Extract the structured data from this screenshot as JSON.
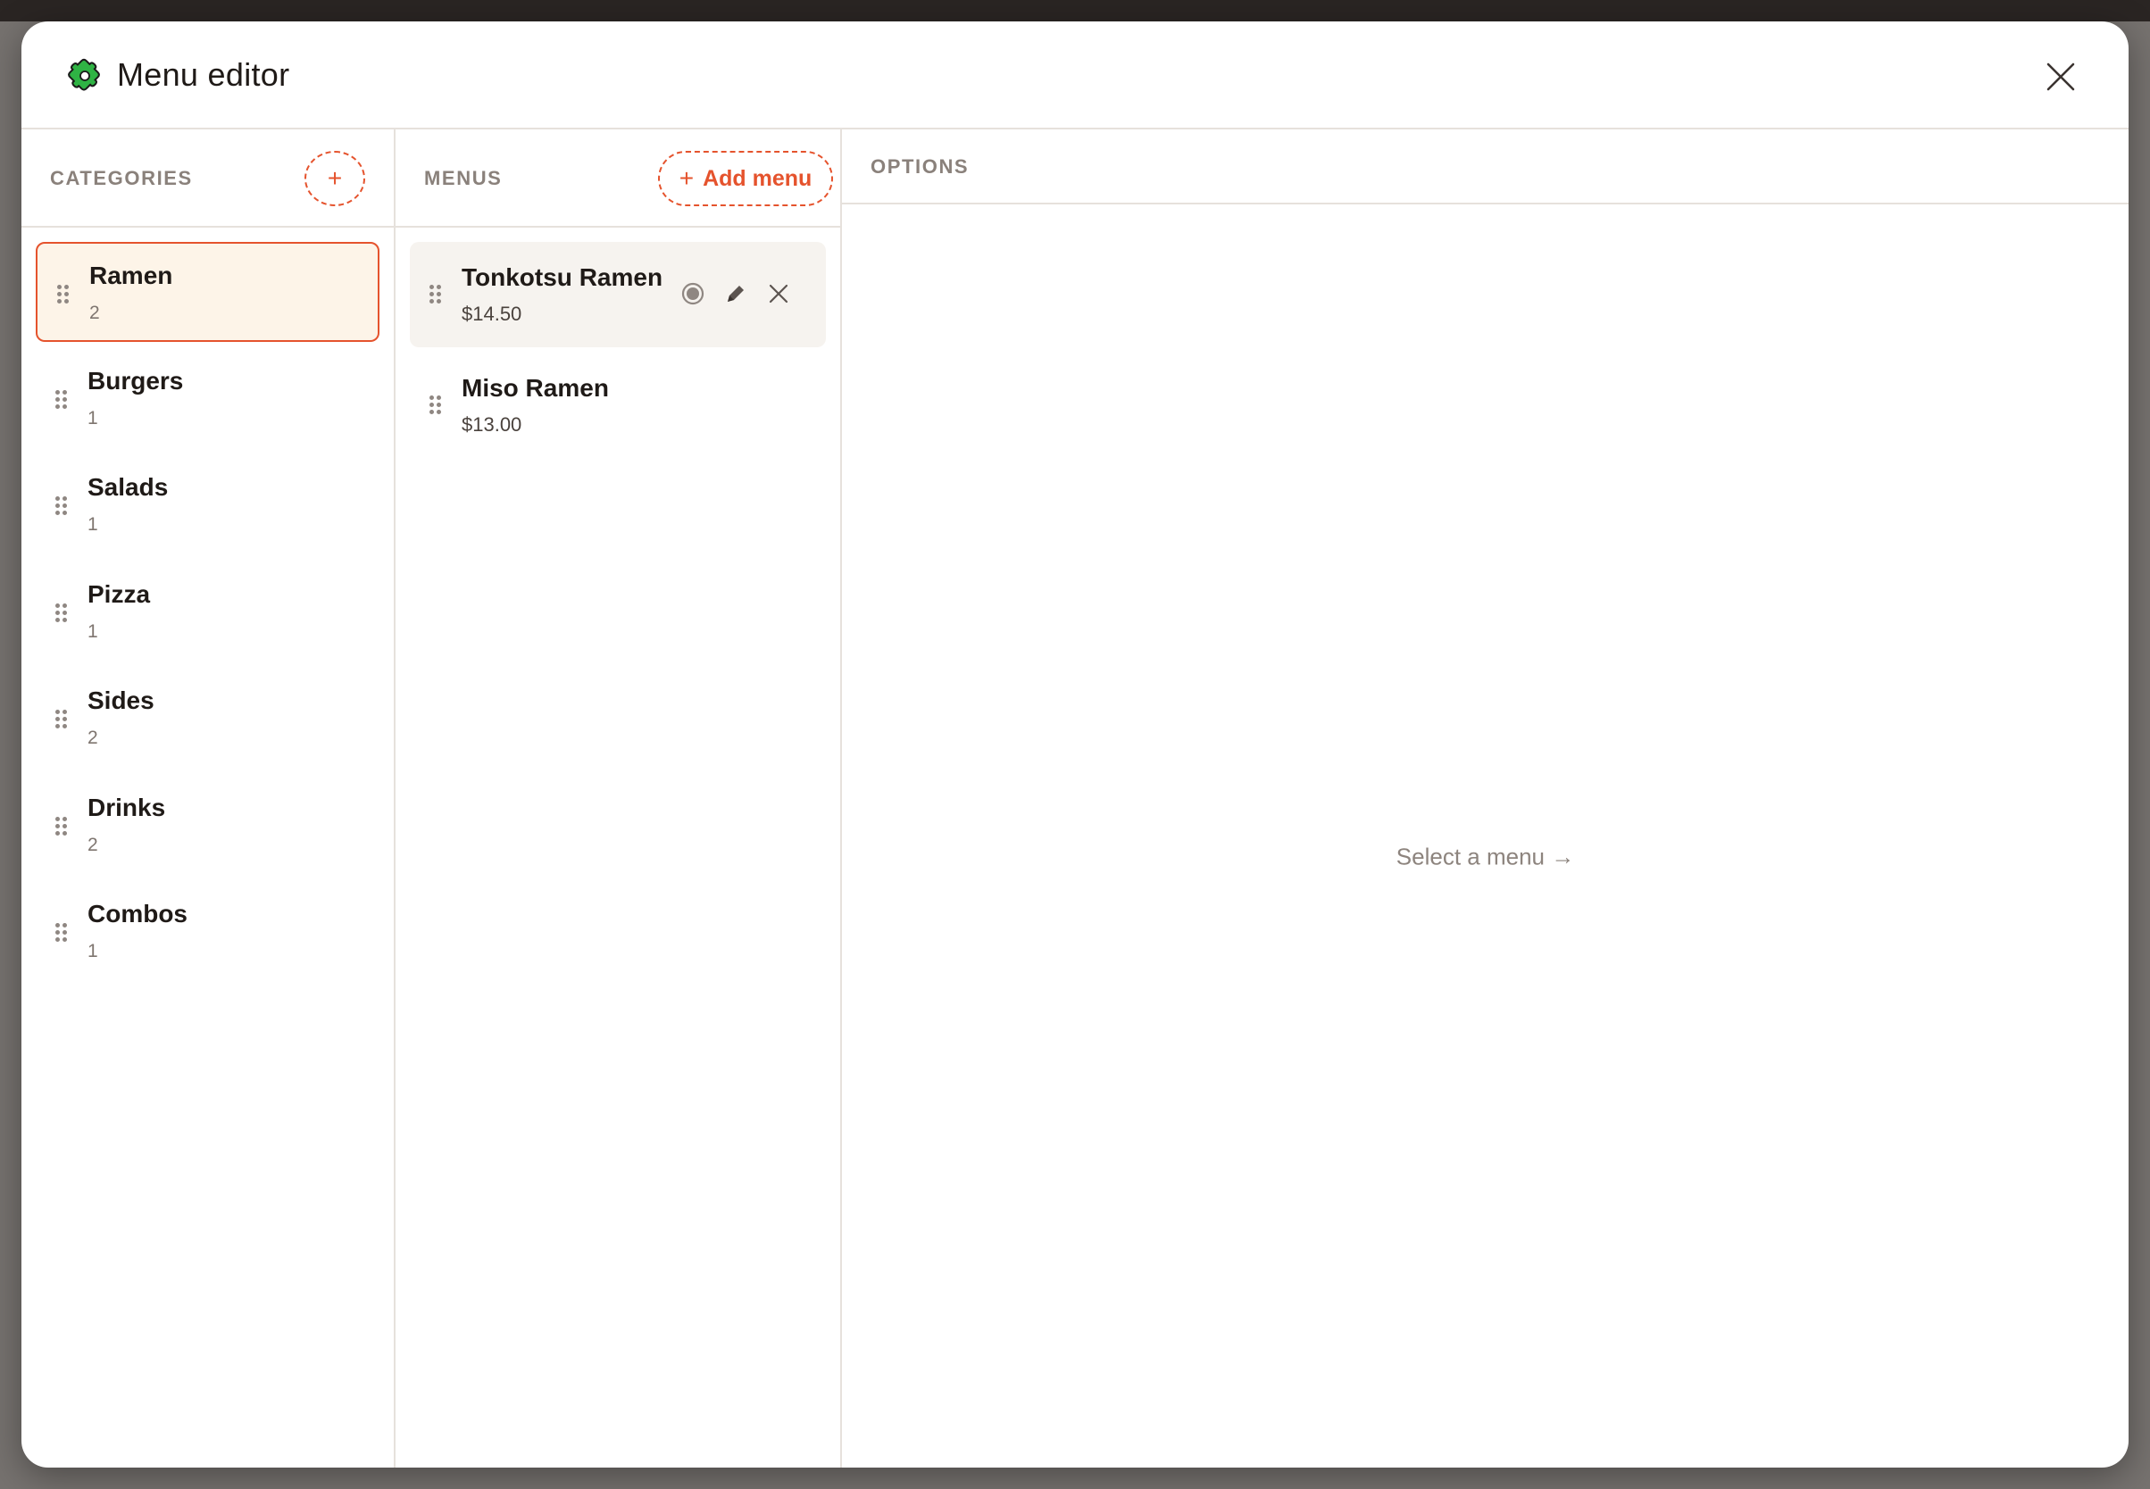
{
  "modal": {
    "title": "Menu editor",
    "logo_icon": "puzzle-icon",
    "close_icon": "close-icon"
  },
  "categories": {
    "header": "CATEGORIES",
    "add_label": "+",
    "items": [
      {
        "name": "Ramen",
        "count": "2",
        "selected": true
      },
      {
        "name": "Burgers",
        "count": "1"
      },
      {
        "name": "Salads",
        "count": "1"
      },
      {
        "name": "Pizza",
        "count": "1"
      },
      {
        "name": "Sides",
        "count": "2"
      },
      {
        "name": "Drinks",
        "count": "2"
      },
      {
        "name": "Combos",
        "count": "1"
      }
    ]
  },
  "menus": {
    "header": "MENUS",
    "add_plus": "+",
    "add_label": "Add menu",
    "items": [
      {
        "name": "Tonkotsu Ramen",
        "price": "$14.50",
        "actions": [
          "toggle-icon",
          "pencil-icon",
          "close-icon"
        ]
      },
      {
        "name": "Miso Ramen",
        "price": "$13.00"
      }
    ]
  },
  "options": {
    "header": "OPTIONS",
    "placeholder": "Select a menu →"
  },
  "colors": {
    "accent": "#e5532d",
    "selected_bg": "#fdf4e8",
    "hover_bg": "#f6f3ef",
    "border": "#e6e1dc",
    "muted_text": "#8a817b"
  }
}
